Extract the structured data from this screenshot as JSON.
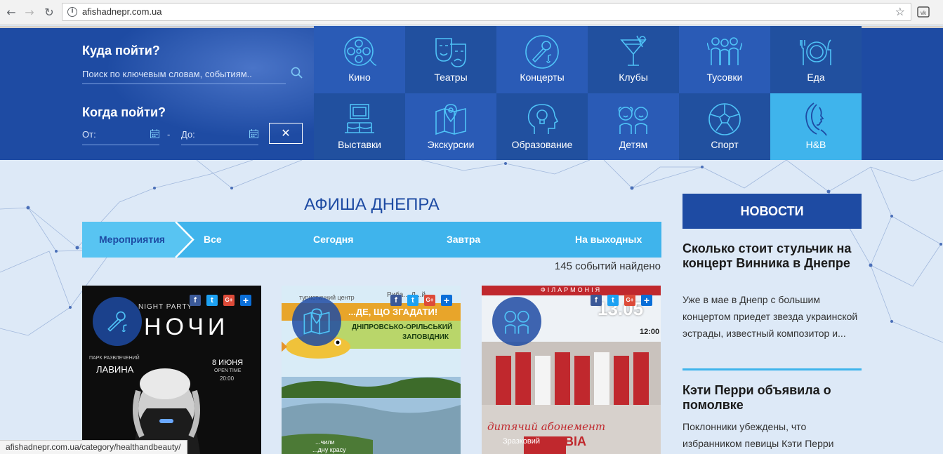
{
  "browser": {
    "url": "afishadnepr.com.ua",
    "status_url": "afishadnepr.com.ua/category/healthandbeauty/"
  },
  "header": {
    "where_title": "Куда пойти?",
    "search_placeholder": "Поиск по ключевым словам, событиям..",
    "when_title": "Когда пойти?",
    "date_from_label": "От:",
    "date_to_label": "До:",
    "date_separator": "-",
    "clear_label": "✕"
  },
  "categories": [
    {
      "label": "Кино",
      "icon": "film-reel-icon"
    },
    {
      "label": "Театры",
      "icon": "theatre-masks-icon"
    },
    {
      "label": "Концерты",
      "icon": "microphone-icon"
    },
    {
      "label": "Клубы",
      "icon": "cocktail-icon"
    },
    {
      "label": "Тусовки",
      "icon": "party-people-icon"
    },
    {
      "label": "Еда",
      "icon": "plate-cutlery-icon"
    },
    {
      "label": "Выставки",
      "icon": "exhibition-frame-icon"
    },
    {
      "label": "Экскурсии",
      "icon": "map-pin-icon"
    },
    {
      "label": "Образование",
      "icon": "lightbulb-head-icon"
    },
    {
      "label": "Детям",
      "icon": "children-icon"
    },
    {
      "label": "Спорт",
      "icon": "soccer-ball-icon"
    },
    {
      "label": "H&B",
      "icon": "woman-profile-icon"
    }
  ],
  "main": {
    "title": "АФИША ДНЕПРА",
    "tabs": [
      "Мероприятия",
      "Все",
      "Сегодня",
      "Завтра",
      "На выходных"
    ],
    "count": "145 событий найдено",
    "cards": [
      {
        "badge_icon": "microphone-icon",
        "poster_texts": [
          "NIGHT PARTY",
          "НОЧИ",
          "ПАРК РАЗВЛЕЧЕНИЙ",
          "ЛАВИНА",
          "8 ИЮНЯ",
          "OPEN TIME",
          "20:00"
        ]
      },
      {
        "badge_icon": "map-pin-icon",
        "poster_texts": [
          "туристичний центр",
          "Риба... Д...й",
          "...ДЕ, ЩО ЗГАДАТИ!",
          "ДНІПРОВСЬКО-ОРІЛЬСЬКИЙ",
          "ЗАПОВІДНИК",
          "...чили",
          "...дну красу"
        ]
      },
      {
        "badge_icon": "children-icon",
        "poster_texts": [
          "ФІЛАРМОНІЯ",
          "13.05",
          "12:00",
          "дитячий абонемент",
          "Зразковий",
          "ВІА"
        ]
      }
    ],
    "share_icons": [
      {
        "label": "f",
        "color": "#3b5998"
      },
      {
        "label": "t",
        "color": "#1da1f2"
      },
      {
        "label": "G+",
        "color": "#dd4b39"
      },
      {
        "label": "+",
        "color": "#0b6fd8"
      }
    ]
  },
  "sidebar": {
    "header": "НОВОСТИ",
    "news": [
      {
        "title": "Сколько стоит стульчик на концерт Винника в Днепре",
        "text": "Уже в мае в Днепр с большим концертом приедет звезда украинской эстрады, известный композитор и..."
      },
      {
        "title": "Кэти Перри объявила о помолвке",
        "text": "Поклонники убеждены, что избранником певицы Кэти Перри"
      }
    ]
  },
  "colors": {
    "header_blue": "#1e4ba3",
    "tile_light": "#2a5bb6",
    "accent_cyan": "#3fb4ec",
    "page_bg": "#dde9f7"
  }
}
